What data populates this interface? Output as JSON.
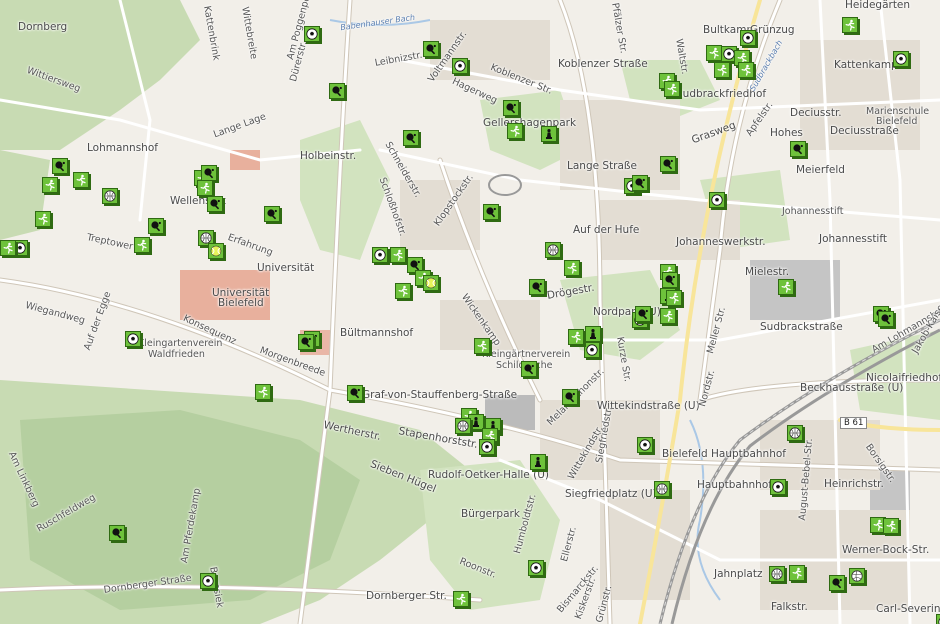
{
  "map": {
    "streets": [
      {
        "key": "dornberg",
        "text": "Dornberg"
      },
      {
        "key": "wittiersweg",
        "text": "Wittiersweg"
      },
      {
        "key": "kattenbrink",
        "text": "Kattenbrink"
      },
      {
        "key": "wittebreite",
        "text": "Wittebreite"
      },
      {
        "key": "am_poggenpohl",
        "text": "Am Poggenpohl"
      },
      {
        "key": "duererstr",
        "text": "Dürerstr."
      },
      {
        "key": "babenhauser_bach",
        "text": "Babenhauser Bach"
      },
      {
        "key": "leibnizstr",
        "text": "Leibnizstr."
      },
      {
        "key": "voltmannstr_n",
        "text": "Voltmannstr."
      },
      {
        "key": "pfaelzer_str",
        "text": "Pfälzer Str."
      },
      {
        "key": "bultkamp",
        "text": "Bultkamp"
      },
      {
        "key": "gruenzug",
        "text": "Grünzug"
      },
      {
        "key": "heidegarten",
        "text": "Heidegärten"
      },
      {
        "key": "koblenzer_str_a",
        "text": "Koblenzer Str."
      },
      {
        "key": "koblenzer_strasse",
        "text": "Koblenzer Straße"
      },
      {
        "key": "waltstr",
        "text": "Waltstr."
      },
      {
        "key": "kattenkamp",
        "text": "Kattenkamp"
      },
      {
        "key": "lange_lage",
        "text": "Lange Lage"
      },
      {
        "key": "hagerweg",
        "text": "Hagerweg"
      },
      {
        "key": "sudbrackfriedhof",
        "text": "Sudbrackfriedhof"
      },
      {
        "key": "sudbrackbach",
        "text": "Sudbrackbach"
      },
      {
        "key": "deciusstr",
        "text": "Deciusstr."
      },
      {
        "key": "marienschule",
        "text": "Marienschule"
      },
      {
        "key": "bielefeld_small",
        "text": "Bielefeld"
      },
      {
        "key": "deciusstrasse",
        "text": "Deciusstraße"
      },
      {
        "key": "lohmannshof",
        "text": "Lohmannshof"
      },
      {
        "key": "gellershagenpark",
        "text": "Gellershagenpark"
      },
      {
        "key": "grasweg",
        "text": "Grasweg"
      },
      {
        "key": "apfelstr",
        "text": "Apfelstr."
      },
      {
        "key": "hohes",
        "text": "Hohes"
      },
      {
        "key": "holbeinstr",
        "text": "Holbeinstr."
      },
      {
        "key": "schneiderstr",
        "text": "Schneiderstr."
      },
      {
        "key": "lange_strasse",
        "text": "Lange Straße"
      },
      {
        "key": "meierfeld",
        "text": "Meierfeld"
      },
      {
        "key": "schlosshofstr",
        "text": "Schloßhofstr."
      },
      {
        "key": "klopstockstr",
        "text": "Klopstockstr."
      },
      {
        "key": "wellensiek",
        "text": "Wellensiek"
      },
      {
        "key": "treptower",
        "text": "Treptower"
      },
      {
        "key": "erfahrung",
        "text": "Erfahrung"
      },
      {
        "key": "johannesstift_a",
        "text": "Johannesstift"
      },
      {
        "key": "johanneswerkstr",
        "text": "Johanneswerkstr."
      },
      {
        "key": "johannesstift_b",
        "text": "Johannesstift"
      },
      {
        "key": "auf_der_hufe",
        "text": "Auf der Hufe"
      },
      {
        "key": "universitaet",
        "text": "Universität"
      },
      {
        "key": "droegestr",
        "text": "Drögestr."
      },
      {
        "key": "mielestr",
        "text": "Mielestr."
      },
      {
        "key": "universitaet_bielefeld_1",
        "text": "Universität"
      },
      {
        "key": "universitaet_bielefeld_2",
        "text": "Bielefeld"
      },
      {
        "key": "wiegandweg",
        "text": "Wiegandweg"
      },
      {
        "key": "auf_der_egge",
        "text": "Auf der Egge"
      },
      {
        "key": "konsequenz",
        "text": "Konsequenz"
      },
      {
        "key": "wickenkamp",
        "text": "Wickenkamp"
      },
      {
        "key": "nordpark",
        "text": "Nordpark (U)"
      },
      {
        "key": "sudbrackstrasse",
        "text": "Sudbrackstraße"
      },
      {
        "key": "am_lohmannshof",
        "text": "Am Lohmannshof"
      },
      {
        "key": "bueltmannshof",
        "text": "Bültmannshof"
      },
      {
        "key": "gartenverein_1",
        "text": "Kleingartenverein"
      },
      {
        "key": "gartenverein_2",
        "text": "Waldfrieden"
      },
      {
        "key": "morgenbreede",
        "text": "Morgenbreede"
      },
      {
        "key": "gaertnerverein_1",
        "text": "Kleingärtnerverein"
      },
      {
        "key": "gaertnerverein_2",
        "text": "Schildesche"
      },
      {
        "key": "kurze_str",
        "text": "Kurze Str."
      },
      {
        "key": "meller_str",
        "text": "Meller Str."
      },
      {
        "key": "nicolaifriedhof",
        "text": "Nicolaifriedhof"
      },
      {
        "key": "jakob_kaiser",
        "text": "Jakob-Kaiser-Str."
      },
      {
        "key": "beckhausstrasse",
        "text": "Beckhausstraße (U)"
      },
      {
        "key": "stauffenberg",
        "text": "Graf-von-Stauffenberg-Straße"
      },
      {
        "key": "melanchthonstr",
        "text": "Melanchthonstr."
      },
      {
        "key": "wittekindstrasse",
        "text": "Wittekindstraße (U)"
      },
      {
        "key": "nordstr",
        "text": "Nordstr."
      },
      {
        "key": "b61",
        "text": "B 61"
      },
      {
        "key": "wertherstr",
        "text": "Wertherstr."
      },
      {
        "key": "stapenhorststr",
        "text": "Stapenhorststr."
      },
      {
        "key": "siegfriedstr",
        "text": "Siegfriedstr."
      },
      {
        "key": "wittekindstr",
        "text": "Wittekindstr."
      },
      {
        "key": "hauptbahnhof_bf",
        "text": "Bielefeld Hauptbahnhof"
      },
      {
        "key": "borsigstr",
        "text": "Borsigstr."
      },
      {
        "key": "am_linkberg",
        "text": "Am Linkberg"
      },
      {
        "key": "sieben_huegel",
        "text": "Sieben Hügel"
      },
      {
        "key": "rudolf_oetker",
        "text": "Rudolf-Oetker-Halle (U)"
      },
      {
        "key": "hauptbahnhof_u",
        "text": "Hauptbahnhof"
      },
      {
        "key": "august_bebel",
        "text": "August-Bebel-Str."
      },
      {
        "key": "heinrichstr",
        "text": "Heinrichstr."
      },
      {
        "key": "siegfriedplatz",
        "text": "Siegfriedplatz (U)"
      },
      {
        "key": "buergerpark",
        "text": "Bürgerpark"
      },
      {
        "key": "am_pferdekamp",
        "text": "Am Pferdekamp"
      },
      {
        "key": "humboldtstr",
        "text": "Humboldtstr."
      },
      {
        "key": "ellerstr",
        "text": "Ellerstr."
      },
      {
        "key": "ruschfeldweg",
        "text": "Ruschfeldweg"
      },
      {
        "key": "werner_bock",
        "text": "Werner-Bock-Str."
      },
      {
        "key": "roonstr",
        "text": "Roonstr."
      },
      {
        "key": "brunsiek",
        "text": "Brunsiek"
      },
      {
        "key": "bismarckstr",
        "text": "Bismarckstr."
      },
      {
        "key": "jahnplatz",
        "text": "Jahnplatz"
      },
      {
        "key": "kiskerstr",
        "text": "Kiskerstr."
      },
      {
        "key": "gruenstr",
        "text": "Grünstr."
      },
      {
        "key": "dornberger_str_a",
        "text": "Dornberger Straße"
      },
      {
        "key": "dornberger_str_b",
        "text": "Dornberger Str."
      },
      {
        "key": "falkstr",
        "text": "Falkstr."
      },
      {
        "key": "carl_severing",
        "text": "Carl-Severing"
      }
    ],
    "colors": {
      "background": "#f2efe9",
      "green_area": "#c8dbb3",
      "forest": "#b5cfa0",
      "water": "#aac8e6",
      "building": "#d9c9b9",
      "campus_building": "#e5a08a",
      "road": "#ffffff",
      "road_casing": "#cfc6b8",
      "main_road": "#f8e59a",
      "rail": "#999999",
      "poi_fill": "#6ec23b",
      "poi_border": "#2f6a12"
    },
    "poi_types": [
      "table-tennis",
      "soccer",
      "chess",
      "athletics",
      "basketball",
      "volleyball",
      "tennis"
    ]
  }
}
